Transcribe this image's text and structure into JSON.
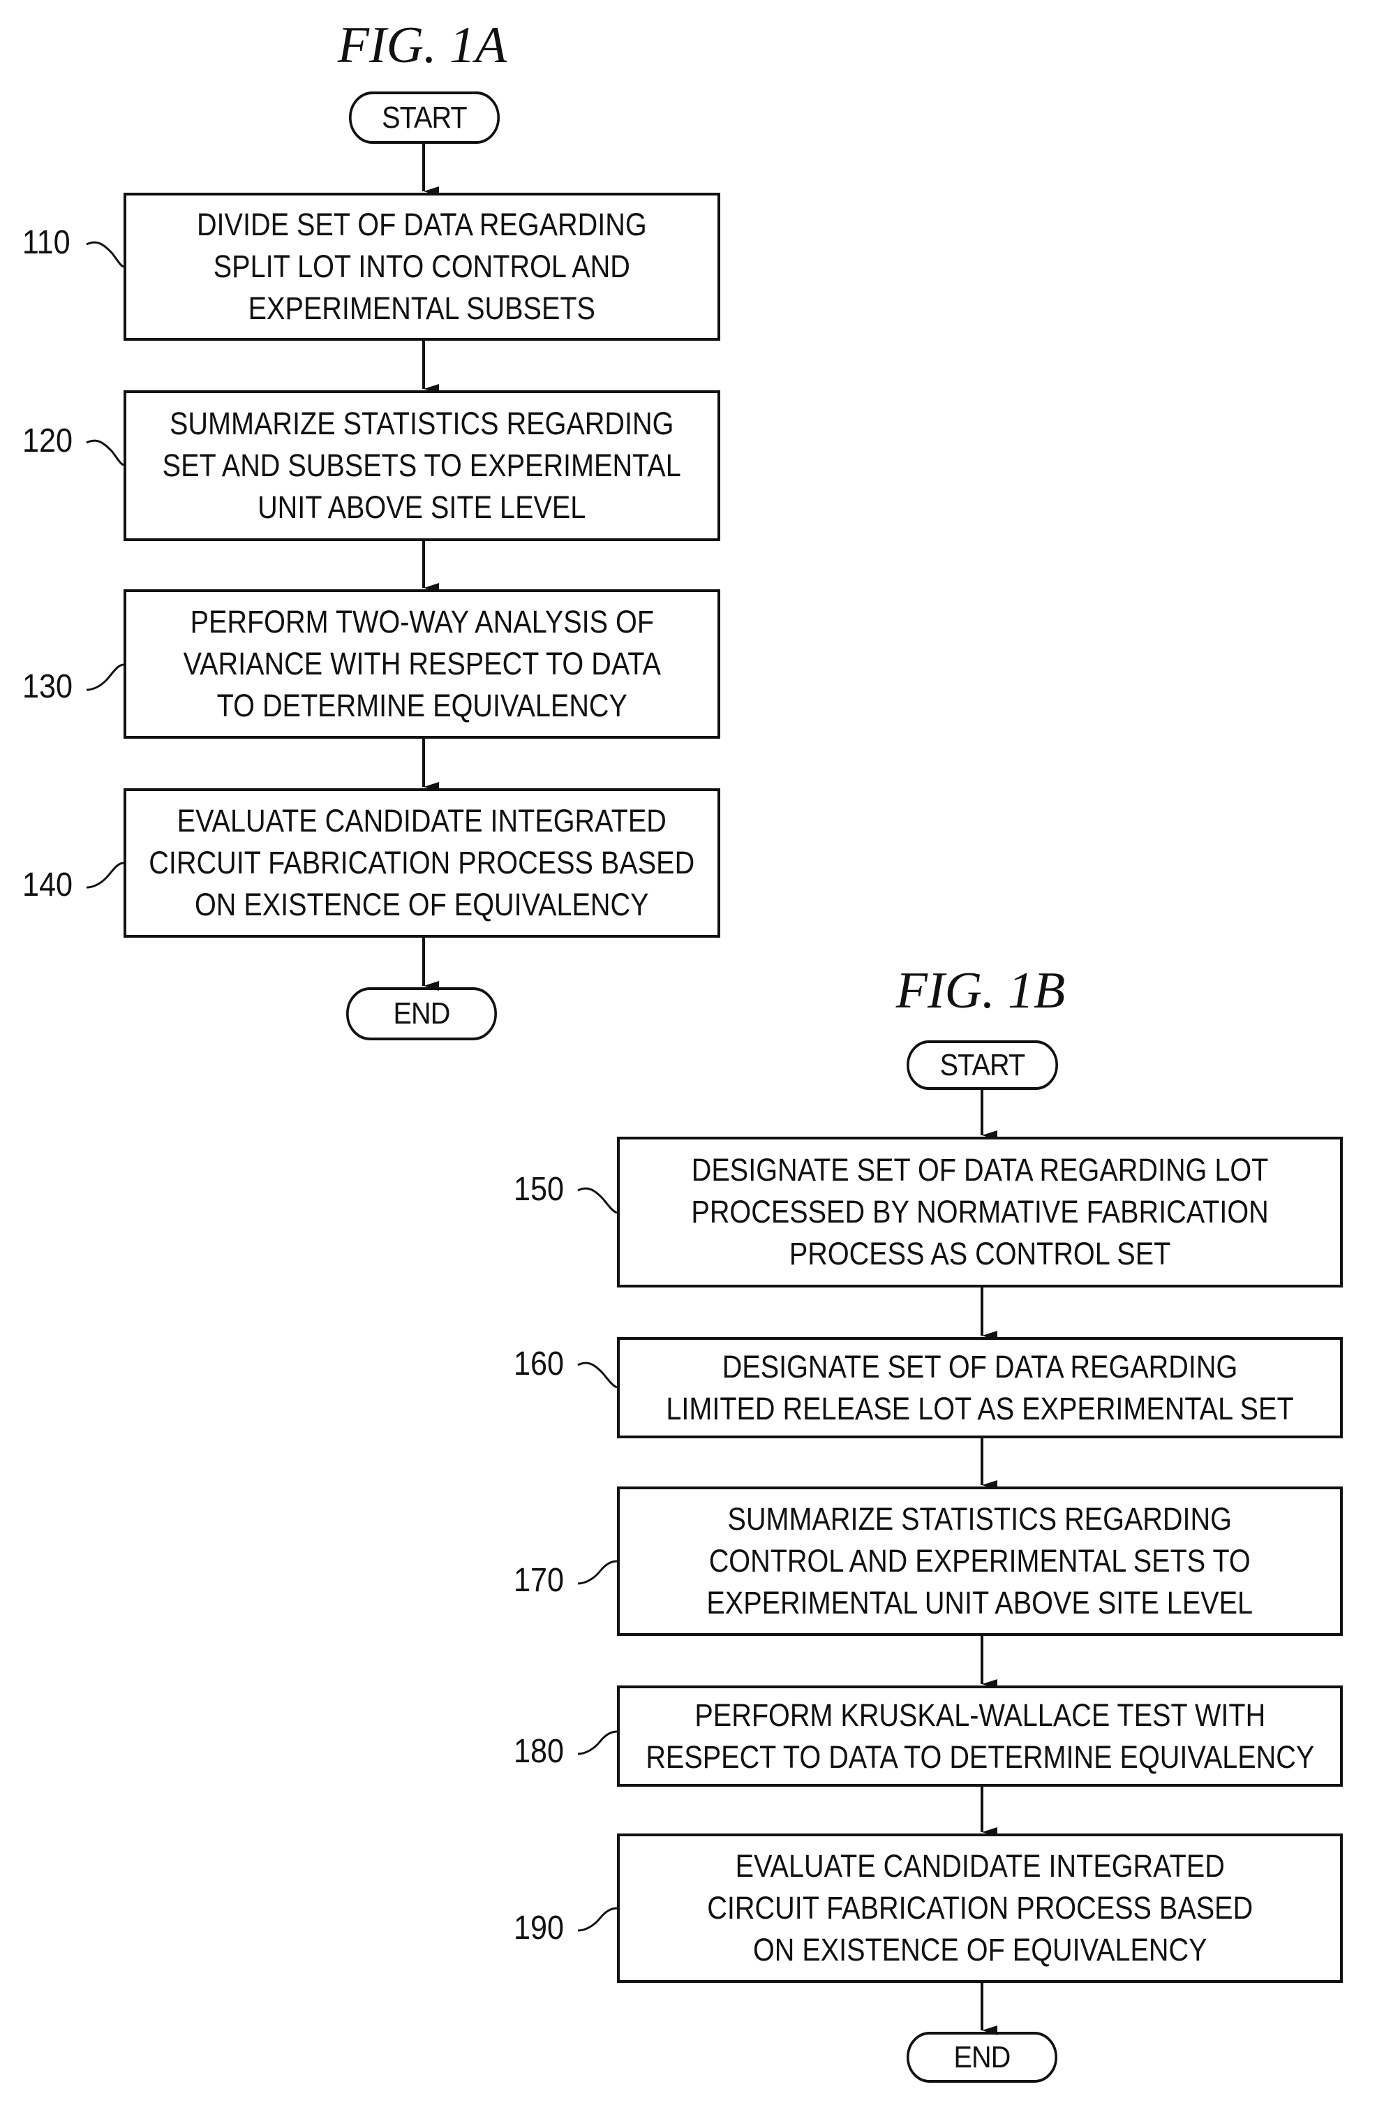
{
  "figures": [
    {
      "title": "FIG. 1A",
      "start_label": "START",
      "end_label": "END",
      "steps": [
        {
          "ref": "110",
          "lines": [
            "DIVIDE SET OF DATA REGARDING",
            "SPLIT LOT INTO CONTROL AND",
            "EXPERIMENTAL SUBSETS"
          ]
        },
        {
          "ref": "120",
          "lines": [
            "SUMMARIZE STATISTICS REGARDING",
            "SET AND SUBSETS TO EXPERIMENTAL",
            "UNIT ABOVE SITE LEVEL"
          ]
        },
        {
          "ref": "130",
          "lines": [
            "PERFORM TWO-WAY ANALYSIS OF",
            "VARIANCE WITH RESPECT TO DATA",
            "TO DETERMINE EQUIVALENCY"
          ]
        },
        {
          "ref": "140",
          "lines": [
            "EVALUATE CANDIDATE INTEGRATED",
            "CIRCUIT FABRICATION PROCESS BASED",
            "ON EXISTENCE OF EQUIVALENCY"
          ]
        }
      ]
    },
    {
      "title": "FIG. 1B",
      "start_label": "START",
      "end_label": "END",
      "steps": [
        {
          "ref": "150",
          "lines": [
            "DESIGNATE SET OF DATA REGARDING LOT",
            "PROCESSED BY NORMATIVE FABRICATION",
            "PROCESS AS CONTROL SET"
          ]
        },
        {
          "ref": "160",
          "lines": [
            "DESIGNATE SET OF DATA REGARDING",
            "LIMITED RELEASE LOT AS EXPERIMENTAL SET"
          ]
        },
        {
          "ref": "170",
          "lines": [
            "SUMMARIZE STATISTICS REGARDING",
            "CONTROL AND EXPERIMENTAL SETS TO",
            "EXPERIMENTAL UNIT ABOVE SITE LEVEL"
          ]
        },
        {
          "ref": "180",
          "lines": [
            "PERFORM KRUSKAL-WALLACE TEST WITH",
            "RESPECT TO DATA TO DETERMINE EQUIVALENCY"
          ]
        },
        {
          "ref": "190",
          "lines": [
            "EVALUATE CANDIDATE INTEGRATED",
            "CIRCUIT FABRICATION PROCESS BASED",
            "ON EXISTENCE OF EQUIVALENCY"
          ]
        }
      ]
    }
  ]
}
